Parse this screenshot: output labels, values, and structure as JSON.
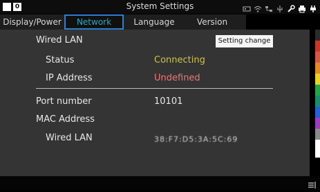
{
  "window": {
    "title": "System Settings",
    "indicator_number": "0"
  },
  "status_icons": [
    "hdd-icon",
    "wifi-icon",
    "network-icon",
    "usb-icon",
    "tool-icon",
    "printer-icon",
    "battery-icon"
  ],
  "tabs": [
    {
      "label": "Display/Power",
      "active": false
    },
    {
      "label": "Network",
      "active": true
    },
    {
      "label": "Language",
      "active": false
    },
    {
      "label": "Version",
      "active": false
    }
  ],
  "network": {
    "wired_lan_header": "Wired LAN",
    "status_label": "Status",
    "status_value": "Connecting",
    "ip_label": "IP Address",
    "ip_value": "Undefined",
    "port_label": "Port number",
    "port_value": "10101",
    "mac_header": "MAC Address",
    "mac_wired_label": "Wired LAN",
    "mac_wired_value": "38:F7:D5:3A:5C:69"
  },
  "tooltip": "Setting change",
  "accent_colors": {
    "active_tab_text": "#25a9c6",
    "active_tab_border": "#2b7fd0",
    "connecting": "#d0c24a",
    "undefined": "#ef7575"
  },
  "side_strip_colors": [
    "#2b2b2b",
    "#c0392b",
    "#d05a4a",
    "#e08a2c",
    "#e6d22a",
    "#27a14a",
    "#1f8a6a",
    "#2a5fd0",
    "#9a3fb5",
    "#8a8a8a",
    "#ffffff"
  ]
}
